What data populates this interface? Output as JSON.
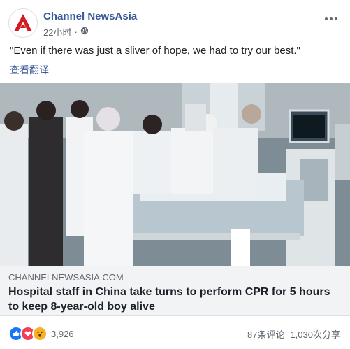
{
  "page": {
    "name": "Channel NewsAsia",
    "time": "22小时",
    "separator": "·"
  },
  "post": {
    "caption": "\"Even if there was just a sliver of hope, we had to try our best.\"",
    "translate_label": "查看翻译"
  },
  "link": {
    "domain": "CHANNELNEWSASIA.COM",
    "title": "Hospital staff in China take turns to perform CPR for 5 hours to keep 8-year-old boy alive"
  },
  "engagement": {
    "reaction_count": "3,926",
    "comments": "87条评论",
    "shares": "1,030次分享"
  },
  "colors": {
    "brand_red": "#d71920",
    "link_blue": "#385898",
    "like_blue": "#1877f2",
    "love_red": "#f33e58",
    "wow_yellow": "#f7b125"
  },
  "icons": [
    "channel-newsasia-logo",
    "globe-icon",
    "more-options-icon",
    "like-reaction-icon",
    "love-reaction-icon",
    "wow-reaction-icon"
  ]
}
